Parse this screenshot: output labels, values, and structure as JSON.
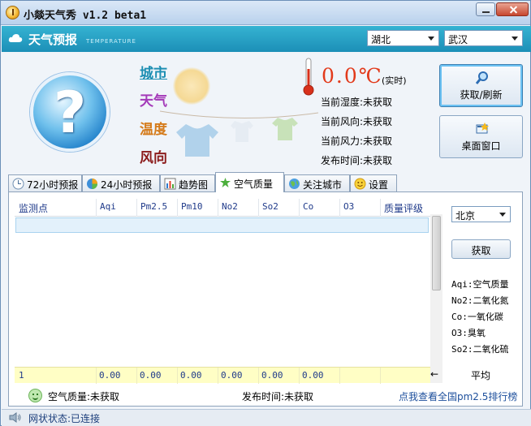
{
  "window": {
    "title": "小燚天气秀 v1.2 beta1"
  },
  "header": {
    "title": "天气预报",
    "subtitle": "TEMPERATURE",
    "province": "湖北",
    "city": "武汉"
  },
  "labels": {
    "city": "城市",
    "weather": "天气",
    "temperature": "温度",
    "wind": "风向"
  },
  "current": {
    "temp": "0.0℃",
    "realtime_note": "(实时)",
    "humidity": "当前湿度:未获取",
    "wind_dir": "当前风向:未获取",
    "wind_power": "当前风力:未获取",
    "publish_time": "发布时间:未获取"
  },
  "buttons": {
    "refresh": "获取/刷新",
    "desktop": "桌面窗口",
    "get": "获取"
  },
  "tabs": [
    {
      "label": "72小时预报",
      "icon": "clock-icon"
    },
    {
      "label": "24小时预报",
      "icon": "pie-chart-icon"
    },
    {
      "label": "趋势图",
      "icon": "bar-chart-icon"
    },
    {
      "label": "空气质量",
      "icon": "leaf-icon"
    },
    {
      "label": "关注城市",
      "icon": "globe-icon"
    },
    {
      "label": "设置",
      "icon": "smiley-icon"
    }
  ],
  "active_tab": "空气质量",
  "air_table": {
    "columns": [
      "监测点",
      "Aqi",
      "Pm2.5",
      "Pm10",
      "No2",
      "So2",
      "Co",
      "O3",
      "质量评级"
    ],
    "average_row": [
      "1",
      "0.00",
      "0.00",
      "0.00",
      "0.00",
      "0.00",
      "0.00",
      "",
      ""
    ],
    "average_label": "平均",
    "average_arrow": "←"
  },
  "station_select": "北京",
  "legend": [
    "Aqi:空气质量",
    "No2:二氧化氮",
    "Co:一氧化碳",
    "O3:臭氧",
    "So2:二氧化硫"
  ],
  "bottom": {
    "air_quality": "空气质量:未获取",
    "publish_time": "发布时间:未获取",
    "rank_link": "点我查看全国pm2.5排行榜"
  },
  "status": {
    "network": "网状状态:已连接"
  },
  "colors": {
    "accent": "#1c8fb7",
    "temp_red": "#e23a1b",
    "link": "#1d4f9c"
  }
}
